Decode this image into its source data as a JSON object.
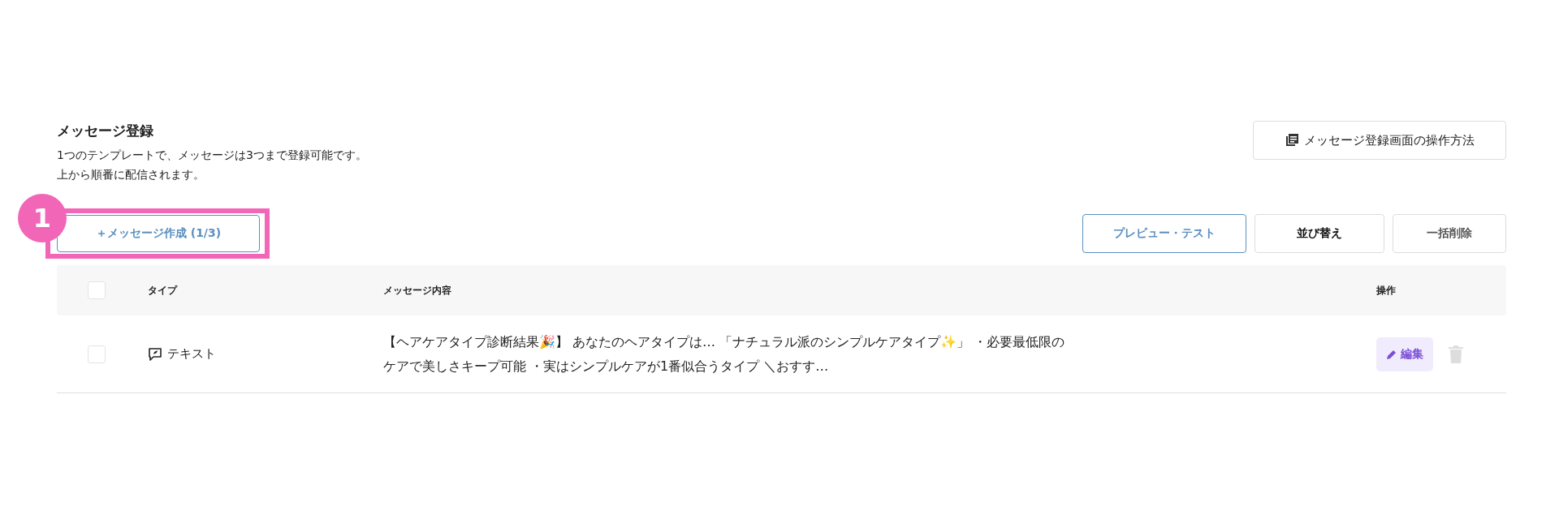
{
  "header": {
    "title": "メッセージ登録",
    "description": [
      "1つのテンプレートで、メッセージは3つまで登録可能です。",
      "上から順番に配信されます。"
    ],
    "help_button": "メッセージ登録画面の操作方法"
  },
  "annotation": {
    "number": "1"
  },
  "toolbar": {
    "create_button": "＋メッセージ作成 (1/3)",
    "actions": [
      {
        "label": "プレビュー・テスト",
        "kind": "primary"
      },
      {
        "label": "並び替え",
        "kind": "strong"
      },
      {
        "label": "一括削除",
        "kind": "muted"
      }
    ]
  },
  "table": {
    "select_all_checked": false,
    "columns": [
      "タイプ",
      "メッセージ内容",
      "操作"
    ],
    "rows": [
      {
        "checked": false,
        "type": "テキスト",
        "content": "【ヘアケアタイプ診断結果🎉】 あなたのヘアタイプは… 「ナチュラル派のシンプルケアタイプ✨」 ・必要最低限のケアで美しさキープ可能 ・実はシンプルケアが1番似合うタイプ ＼おすす…",
        "edit_button": "編集"
      }
    ]
  }
}
